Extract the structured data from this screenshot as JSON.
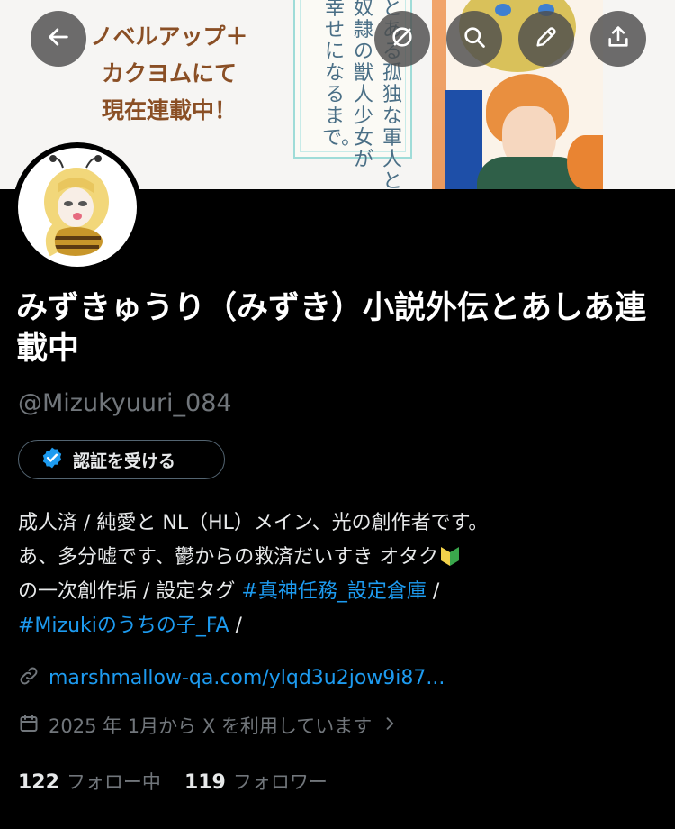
{
  "banner": {
    "lines": [
      "ノベルアップ＋",
      "カクヨムにて",
      "現在連載中！"
    ],
    "cover_columns": [
      "とある孤独な軍人と",
      "奴隷の獣人少女が",
      "幸せになるまで。"
    ]
  },
  "nav": {
    "back": "back-arrow-icon",
    "ring": "grok-icon",
    "search": "search-icon",
    "edit": "pencil-icon",
    "share": "share-icon"
  },
  "profile": {
    "display_name": "みずきゅうり（みずき）小説外伝とあしあ連載中",
    "handle": "@Mizukyuuri_084",
    "verify_label": "認証を受ける",
    "bio": {
      "line1": "成人済 / 純愛と NL（HL）メイン、光の創作者です。",
      "line2": "あ、多分嘘です、鬱からの救済だいすき オタク",
      "line3_pre": "の一次創作垢 / 設定タグ ",
      "hashtag1": "#真神任務_設定倉庫",
      "line3_post": " /",
      "hashtag2": "#Mizukiのうちの子_FA",
      "line4_post": " /"
    },
    "link": "marshmallow-qa.com/ylqd3u2jow9i87...",
    "joined": "2025 年 1月から X を利用しています",
    "following_count": "122",
    "following_label": "フォロー中",
    "followers_count": "119",
    "followers_label": "フォロワー"
  },
  "colors": {
    "background": "#000000",
    "link": "#1d9bf0",
    "secondary_text": "#71767b",
    "verified_badge": "#1d9bf0"
  }
}
